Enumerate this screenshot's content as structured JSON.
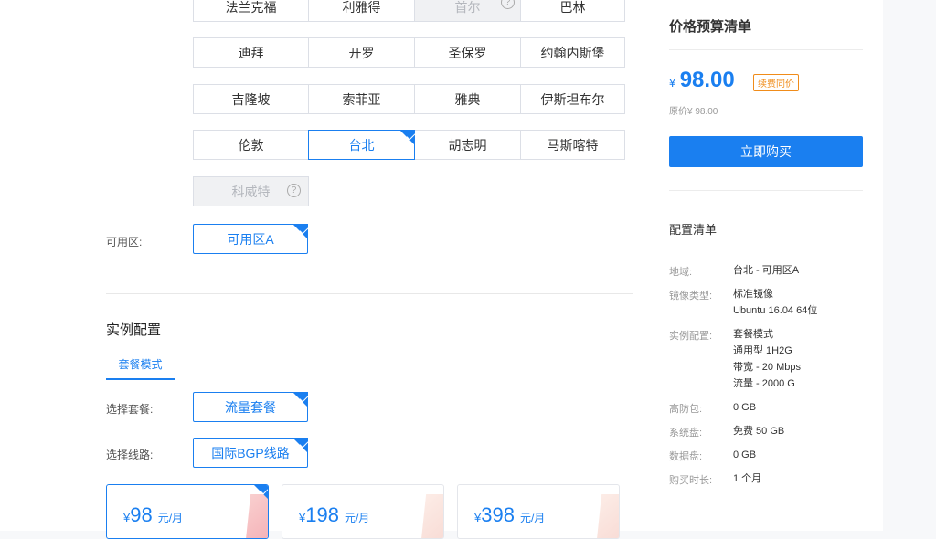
{
  "regions": {
    "rows": [
      [
        "法兰克福",
        "利雅得",
        "首尔",
        "巴林"
      ],
      [
        "迪拜",
        "开罗",
        "圣保罗",
        "约翰内斯堡"
      ],
      [
        "吉隆坡",
        "索菲亚",
        "雅典",
        "伊斯坦布尔"
      ],
      [
        "伦敦",
        "台北",
        "胡志明",
        "马斯喀特"
      ],
      [
        "科威特"
      ]
    ],
    "selected": "台北",
    "disabled": [
      "首尔",
      "科威特"
    ],
    "help_symbol": "?"
  },
  "zone": {
    "label": "可用区:",
    "value": "可用区A"
  },
  "instance": {
    "title": "实例配置",
    "tab": "套餐模式",
    "package_label": "选择套餐:",
    "package_value": "流量套餐",
    "line_label": "选择线路:",
    "line_value": "国际BGP线路",
    "plans": [
      {
        "currency": "¥",
        "price": "98",
        "unit": "元/月",
        "selected": true
      },
      {
        "currency": "¥",
        "price": "198",
        "unit": "元/月",
        "selected": false
      },
      {
        "currency": "¥",
        "price": "398",
        "unit": "元/月",
        "selected": false
      }
    ]
  },
  "summary": {
    "title": "价格预算清单",
    "currency": "¥",
    "price": "98.00",
    "badge": "续费同价",
    "original": "原价¥ 98.00",
    "buy_label": "立即购买",
    "config_title": "配置清单",
    "items": [
      {
        "label": "地域:",
        "value": "台北 - 可用区A"
      },
      {
        "label": "镜像类型:",
        "value": "标准镜像\nUbuntu 16.04 64位"
      },
      {
        "label": "实例配置:",
        "value": "套餐模式\n通用型 1H2G\n带宽 - 20 Mbps\n流量 - 2000 G"
      },
      {
        "label": "高防包:",
        "value": "0 GB"
      },
      {
        "label": "系统盘:",
        "value": "免费 50 GB"
      },
      {
        "label": "数据盘:",
        "value": "0 GB"
      },
      {
        "label": "购买时长:",
        "value": "1 个月"
      }
    ]
  },
  "colors": {
    "accent": "#1a7ff0",
    "badge": "#f08c1a",
    "price": "#1a7ff0"
  }
}
